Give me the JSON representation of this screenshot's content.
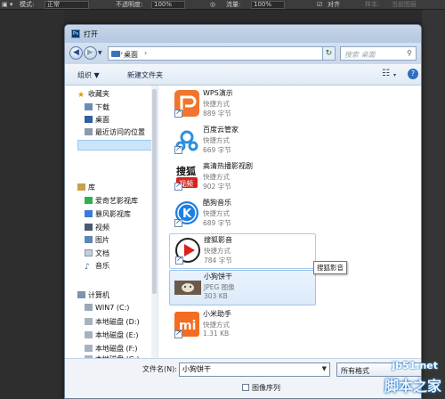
{
  "ps_bar": {
    "mode_label": "模式:",
    "mode_value": "正常",
    "opacity_label": "不透明度:",
    "opacity_value": "100%",
    "flow_label": "流量:",
    "flow_value": "100%",
    "align_label": "对齐",
    "sample_label": "样本:",
    "sample_value": "当前图层"
  },
  "dialog": {
    "title": "打开",
    "address": "桌面",
    "search_placeholder": "搜索 桌面",
    "toolbar": {
      "organize": "组织 ▼",
      "new_folder": "新建文件夹"
    },
    "nav": {
      "favorites": "收藏夹",
      "downloads": "下载",
      "desktop": "桌面",
      "recent": "最近访问的位置",
      "libraries": "库",
      "iqiyi": "爱奇艺影视库",
      "baofeng": "暴风影视库",
      "videos": "视频",
      "pictures": "图片",
      "documents": "文档",
      "music": "音乐",
      "computer": "计算机",
      "win7": "WIN7 (C:)",
      "disk_d": "本地磁盘 (D:)",
      "disk_e": "本地磁盘 (E:)",
      "disk_f": "本地磁盘 (F:)",
      "disk_g": "本地磁盘 (G:)"
    },
    "files": [
      {
        "name": "WPS演示",
        "type": "快捷方式",
        "size": "889 字节",
        "icon": "wps-presentation-icon",
        "color": "#f0762e"
      },
      {
        "name": "百度云管家",
        "type": "快捷方式",
        "size": "669 字节",
        "icon": "baidu-cloud-icon",
        "color": "#2c8fe0"
      },
      {
        "name": "高清热播影视剧",
        "type": "快捷方式",
        "size": "902 字节",
        "icon": "sohu-video-icon",
        "color": "#d9221c"
      },
      {
        "name": "酷狗音乐",
        "type": "快捷方式",
        "size": "689 字节",
        "icon": "kugou-music-icon",
        "color": "#1f7fe0"
      },
      {
        "name": "搜狐影音",
        "type": "快捷方式",
        "size": "784 字节",
        "icon": "sohu-player-icon",
        "color": "#d9221c"
      },
      {
        "name": "小狗饼干",
        "type": "JPEG 图像",
        "size": "303 KB",
        "icon": "dog-photo-thumbnail",
        "color": "#6b5a4a"
      },
      {
        "name": "小米助手",
        "type": "快捷方式",
        "size": "1.31 KB",
        "icon": "xiaomi-assistant-icon",
        "color": "#f36c21"
      }
    ],
    "tooltip": "搜狐影音",
    "filename_label": "文件名(N):",
    "filename_value": "小狗饼干",
    "format_value": "所有格式",
    "image_sequence_label": "图像序列"
  },
  "watermark": {
    "url": "jb51.net",
    "text": "脚本之家"
  }
}
